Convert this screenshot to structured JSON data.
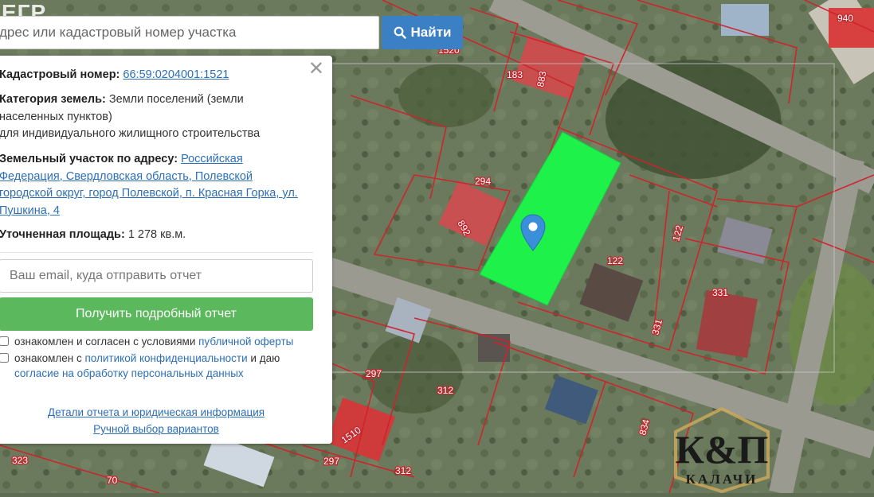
{
  "search": {
    "placeholder": "дрес или кадастровый номер участка",
    "button_label": "Найти"
  },
  "watermark": "ЕГР",
  "info": {
    "cadastral_label": "Кадастровый номер:",
    "cadastral_value": "66:59:0204001:1521",
    "category_label": "Категория земель:",
    "category_value_1": "Земли поселений (земли",
    "category_value_2": "населенных пунктов)",
    "category_value_3": "для индивидуального жилищного строительства",
    "address_label": "Земельный участок по адресу:",
    "address_line_1": "Российская",
    "address_line_2": "Федерация, Свердловская область, Полевской",
    "address_line_3": "городской округ, город Полевской, п. Красная Горка, ул.",
    "address_line_4": "Пушкина, 4",
    "area_label": "Уточненная площадь:",
    "area_value": "1 278 кв.м."
  },
  "form": {
    "email_placeholder": "Ваш email, куда отправить отчет",
    "submit_label": "Получить подробный отчет",
    "agree1_text": "ознакомлен и согласен с условиями",
    "agree1_link": "публичной оферты",
    "agree2_text": "ознакомлен с",
    "agree2_link": "политикой конфиденциальности",
    "agree2_text2": "и даю",
    "agree2_link2": "согласие на обработку персональных данных"
  },
  "links": {
    "details": "Детали отчета и юридическая информация",
    "manual": "Ручной выбор вариантов"
  },
  "map_labels": [
    "1520",
    "183",
    "883",
    "294",
    "892",
    "122",
    "122",
    "331",
    "331",
    "297",
    "312",
    "1510",
    "297",
    "312",
    "323",
    "70",
    "834",
    "940"
  ],
  "logo": {
    "letters": "К&П",
    "text": "КАЛАЧИ"
  },
  "colors": {
    "selected_parcel": "#1ef14a",
    "parcel_border": "#d0222b",
    "accent_blue": "#3b7fc4",
    "accent_green": "#5cb85c"
  }
}
